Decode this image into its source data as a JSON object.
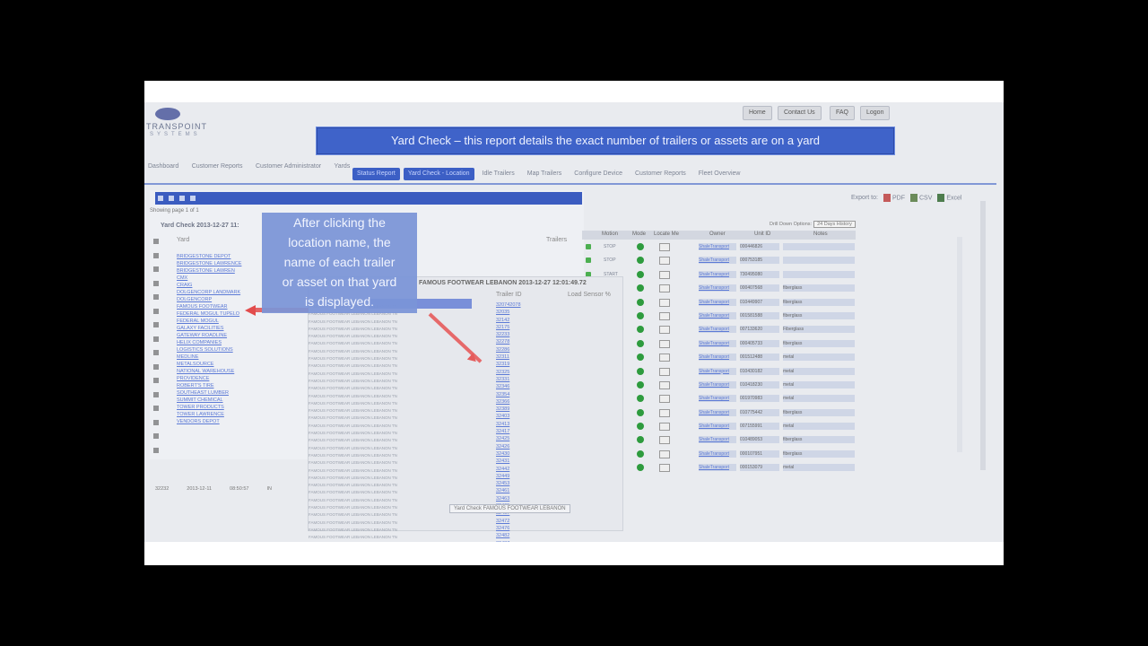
{
  "caption": "Yard Check – this  report details the exact number of trailers or assets are on a yard",
  "logo": {
    "text": "TRANSPOINT",
    "sub": "SYSTEMS"
  },
  "top_buttons": [
    "Home",
    "Contact Us",
    "FAQ",
    "Logon"
  ],
  "main_nav": [
    "Dashboard",
    "Customer Reports",
    "Customer Administrator",
    "Yards"
  ],
  "tabs": [
    "Status Report",
    "Yard Check - Location",
    "Idle Trailers",
    "Map Trailers",
    "Configure Device",
    "Customer Reports",
    "Fleet Overview"
  ],
  "export": {
    "label": "Export to:",
    "options": [
      "PDF",
      "CSV",
      "Excel"
    ]
  },
  "left_panel": {
    "showing": "Showing page  1  of  1",
    "title": "Yard Check 2013-12-27 11:",
    "yard_header": "Yard",
    "trailers_header": "Trailers",
    "yards": [
      "BRIDGESTONE DEPOT",
      "BRIDGESTONE LAWRENCE",
      "BRIDGESTONE LAWREN",
      "CMX",
      "CRAIG",
      "DOLGENCORP LANDMARK",
      "DOLGENCORP",
      "FAMOUS FOOTWEAR",
      "FEDERAL MOGUL TUPELO",
      "FEDERAL MOGUL",
      "GALAXY FACILITIES",
      "GATEWAY ROADLINE",
      "HELIX COMPANIES",
      "LOGISTICS SOLUTIONS",
      "MEDLINE",
      "METALSOURCE",
      "NATIONAL WAREHOUSE",
      "PROVIDENCE",
      "ROBERT'S TIRE",
      "SOUTHEAST LUMBER",
      "SUMMIT CHEMICAL",
      "TOWER PRODUCTS",
      "TOWER LAWRENCE",
      "VENDORS DEPOT"
    ]
  },
  "popup": {
    "title": "FAMOUS FOOTWEAR LEBANON 2013-12-27 12:01:49.72",
    "col_trailer": "Trailer ID",
    "col_sensor": "Load Sensor %",
    "location_label": "FAMOUS FOOTWEAR LEBANON LEBANON TN",
    "trailer_ids": [
      "320742078",
      "32035",
      "32142",
      "32175",
      "32233",
      "32278",
      "32286",
      "32311",
      "32319",
      "32325",
      "32331",
      "32346",
      "32354",
      "32366",
      "32389",
      "32403",
      "32413",
      "32417",
      "32425",
      "32426",
      "32430",
      "32431",
      "32442",
      "32449",
      "32453",
      "32461",
      "32463",
      "32465",
      "32467",
      "32472",
      "32476",
      "32482",
      "32487",
      "32490",
      "32493"
    ],
    "button": "Yard Check FAMOUS FOOTWEAR LEBANON"
  },
  "callout": [
    "After clicking the",
    "location name, the",
    "name of each trailer",
    "or asset on that yard",
    "is displayed."
  ],
  "filter": {
    "label": "Drill Down Options:",
    "value": "24 Days History"
  },
  "right_table": {
    "headers": [
      "Motion",
      "Mode",
      "Locate Me",
      "Owner",
      "Unit ID",
      "Notes"
    ],
    "rows": [
      {
        "motion": "STOP",
        "owner": "ShaleTransport",
        "unit": "000446826",
        "note": ""
      },
      {
        "motion": "STOP",
        "owner": "ShaleTransport",
        "unit": "000753185",
        "note": ""
      },
      {
        "motion": "START",
        "owner": "ShaleTransport",
        "unit": "730495080",
        "note": ""
      },
      {
        "motion": "",
        "owner": "ShaleTransport",
        "unit": "000407568",
        "note": "fiberglass"
      },
      {
        "motion": "",
        "owner": "ShaleTransport",
        "unit": "010449907",
        "note": "fiberglass"
      },
      {
        "motion": "",
        "owner": "ShaleTransport",
        "unit": "001581588",
        "note": "fiberglass"
      },
      {
        "motion": "",
        "owner": "ShaleTransport",
        "unit": "007133620",
        "note": "Fiberglass"
      },
      {
        "motion": "",
        "owner": "ShaleTransport",
        "unit": "000405733",
        "note": "fiberglass"
      },
      {
        "motion": "",
        "owner": "ShaleTransport",
        "unit": "001512488",
        "note": "metal"
      },
      {
        "motion": "",
        "owner": "ShaleTransport",
        "unit": "010430182",
        "note": "metal"
      },
      {
        "motion": "",
        "owner": "ShaleTransport",
        "unit": "010418230",
        "note": "metal"
      },
      {
        "motion": "",
        "owner": "ShaleTransport",
        "unit": "001970983",
        "note": "metal"
      },
      {
        "motion": "",
        "owner": "ShaleTransport",
        "unit": "010775442",
        "note": "fiberglass"
      },
      {
        "motion": "",
        "owner": "ShaleTransport",
        "unit": "007155991",
        "note": "metal"
      },
      {
        "motion": "",
        "owner": "ShaleTransport",
        "unit": "010489053",
        "note": "fiberglass"
      },
      {
        "motion": "",
        "owner": "ShaleTransport",
        "unit": "000107951",
        "note": "fiberglass"
      },
      {
        "motion": "",
        "owner": "ShaleTransport",
        "unit": "000153079",
        "note": "metal"
      }
    ]
  },
  "bottom_row": [
    "32232",
    "2013-12-11",
    "08:50:57",
    "IN"
  ]
}
